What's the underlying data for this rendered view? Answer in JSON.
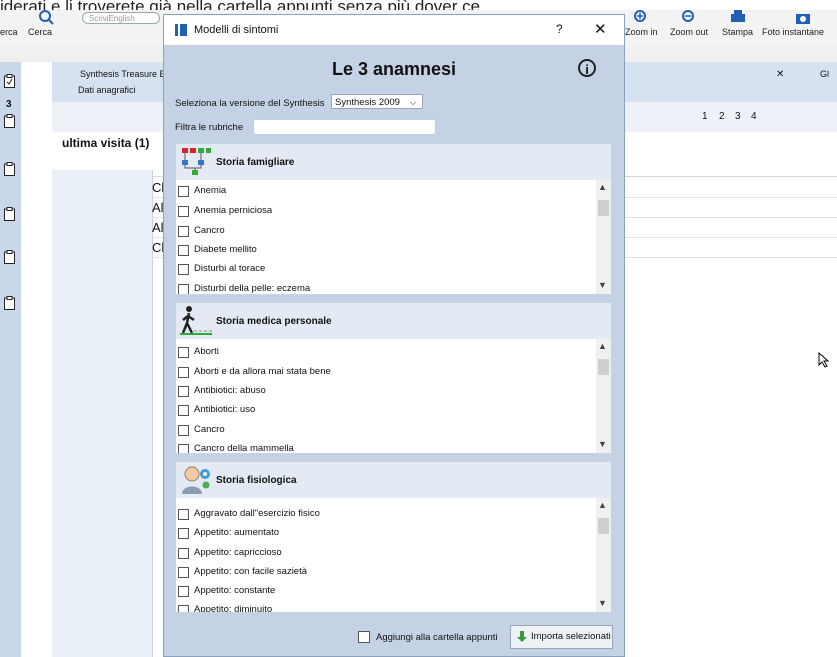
{
  "banner_text": "iderati e li troverete già nella cartella appunti senza più dover ce",
  "ribbon": {
    "left_labels": [
      "erca",
      "Cerca"
    ],
    "search_placeholder": "ScriviEnglish",
    "right_labels": [
      "Zoom in",
      "Zoom out",
      "Stampa",
      "Foto instantane"
    ]
  },
  "workspace": {
    "tab_title": "Synthesis Treasure E",
    "subtab": "Dati anagrafici",
    "count": "3",
    "visit_label": "ultima visita (1)",
    "grid_rows": [
      "Cl",
      "Al",
      "Al",
      "Cl"
    ],
    "toolbar_numbers": [
      "1",
      "2",
      "3",
      "4"
    ],
    "right_tab": "Gl"
  },
  "dialog": {
    "title": "Modelli di sintomi",
    "help": "?",
    "close": "✕",
    "heading": "Le 3 anamnesi",
    "info": "i",
    "version_label": "Seleziona la versione del Synthesis",
    "version_value": "Synthesis 2009",
    "filter_label": "Filtra le rubriche",
    "sections": [
      {
        "title": "Storia famigliare",
        "items": [
          "Anemia",
          "Anemia perniciosa",
          "Cancro",
          "Diabete mellito",
          "Disturbi al torace",
          "Disturbi della pelle: eczema"
        ]
      },
      {
        "title": "Storia medica personale",
        "items": [
          "Aborti",
          "Aborti e da allora mai stata bene",
          "Antibiotici: abuso",
          "Antibiotici: uso",
          "Cancro",
          "Cancro della mammella"
        ]
      },
      {
        "title": "Storia fisiologica",
        "items": [
          "Aggravato dall\"esercizio fisico",
          "Appetito: aumentato",
          "Appetito: capriccioso",
          "Appetito: con facile sazietà",
          "Appetito: constante",
          "Appetito: diminuito"
        ]
      }
    ],
    "add_to_notes": "Aggiungi alla cartella appunti",
    "import_button": "Importa selezionati"
  }
}
